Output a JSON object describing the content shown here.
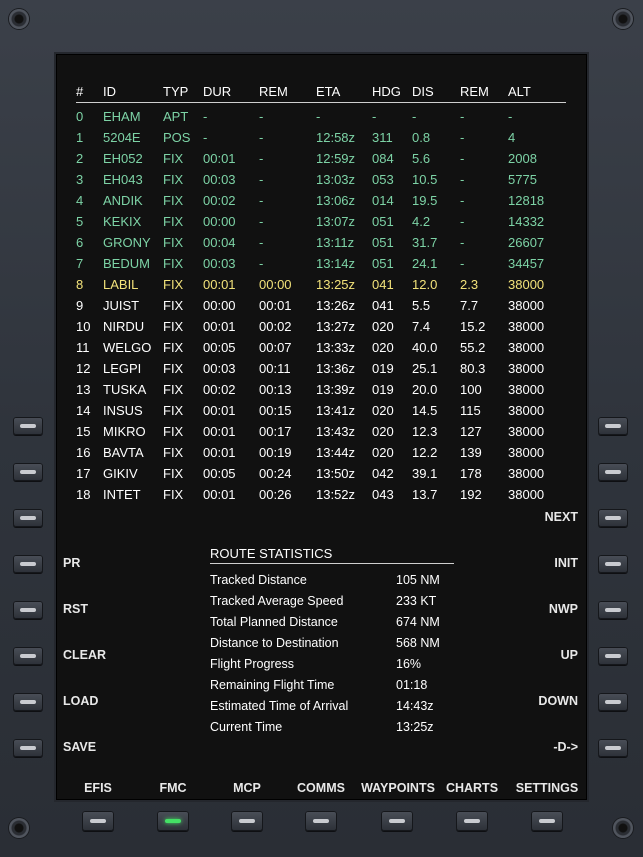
{
  "columns": [
    "#",
    "ID",
    "TYP",
    "DUR",
    "REM",
    "ETA",
    "HDG",
    "DIS",
    "REM",
    "ALT"
  ],
  "waypoints": [
    {
      "n": "0",
      "id": "EHAM",
      "typ": "APT",
      "dur": "-",
      "rem": "-",
      "eta": "-",
      "hdg": "-",
      "dis": "-",
      "rem2": "-",
      "alt": "-",
      "state": "past"
    },
    {
      "n": "1",
      "id": "5204E",
      "typ": "POS",
      "dur": "-",
      "rem": "-",
      "eta": "12:58z",
      "hdg": "311",
      "dis": "0.8",
      "rem2": "-",
      "alt": "4",
      "state": "past"
    },
    {
      "n": "2",
      "id": "EH052",
      "typ": "FIX",
      "dur": "00:01",
      "rem": "-",
      "eta": "12:59z",
      "hdg": "084",
      "dis": "5.6",
      "rem2": "-",
      "alt": "2008",
      "state": "past"
    },
    {
      "n": "3",
      "id": "EH043",
      "typ": "FIX",
      "dur": "00:03",
      "rem": "-",
      "eta": "13:03z",
      "hdg": "053",
      "dis": "10.5",
      "rem2": "-",
      "alt": "5775",
      "state": "past"
    },
    {
      "n": "4",
      "id": "ANDIK",
      "typ": "FIX",
      "dur": "00:02",
      "rem": "-",
      "eta": "13:06z",
      "hdg": "014",
      "dis": "19.5",
      "rem2": "-",
      "alt": "12818",
      "state": "past"
    },
    {
      "n": "5",
      "id": "KEKIX",
      "typ": "FIX",
      "dur": "00:00",
      "rem": "-",
      "eta": "13:07z",
      "hdg": "051",
      "dis": "4.2",
      "rem2": "-",
      "alt": "14332",
      "state": "past"
    },
    {
      "n": "6",
      "id": "GRONY",
      "typ": "FIX",
      "dur": "00:04",
      "rem": "-",
      "eta": "13:11z",
      "hdg": "051",
      "dis": "31.7",
      "rem2": "-",
      "alt": "26607",
      "state": "past"
    },
    {
      "n": "7",
      "id": "BEDUM",
      "typ": "FIX",
      "dur": "00:03",
      "rem": "-",
      "eta": "13:14z",
      "hdg": "051",
      "dis": "24.1",
      "rem2": "-",
      "alt": "34457",
      "state": "past"
    },
    {
      "n": "8",
      "id": "LABIL",
      "typ": "FIX",
      "dur": "00:01",
      "rem": "00:00",
      "eta": "13:25z",
      "hdg": "041",
      "dis": "12.0",
      "rem2": "2.3",
      "alt": "38000",
      "state": "active"
    },
    {
      "n": "9",
      "id": "JUIST",
      "typ": "FIX",
      "dur": "00:00",
      "rem": "00:01",
      "eta": "13:26z",
      "hdg": "041",
      "dis": "5.5",
      "rem2": "7.7",
      "alt": "38000",
      "state": "future"
    },
    {
      "n": "10",
      "id": "NIRDU",
      "typ": "FIX",
      "dur": "00:01",
      "rem": "00:02",
      "eta": "13:27z",
      "hdg": "020",
      "dis": "7.4",
      "rem2": "15.2",
      "alt": "38000",
      "state": "future"
    },
    {
      "n": "11",
      "id": "WELGO",
      "typ": "FIX",
      "dur": "00:05",
      "rem": "00:07",
      "eta": "13:33z",
      "hdg": "020",
      "dis": "40.0",
      "rem2": "55.2",
      "alt": "38000",
      "state": "future"
    },
    {
      "n": "12",
      "id": "LEGPI",
      "typ": "FIX",
      "dur": "00:03",
      "rem": "00:11",
      "eta": "13:36z",
      "hdg": "019",
      "dis": "25.1",
      "rem2": "80.3",
      "alt": "38000",
      "state": "future"
    },
    {
      "n": "13",
      "id": "TUSKA",
      "typ": "FIX",
      "dur": "00:02",
      "rem": "00:13",
      "eta": "13:39z",
      "hdg": "019",
      "dis": "20.0",
      "rem2": "100",
      "alt": "38000",
      "state": "future"
    },
    {
      "n": "14",
      "id": "INSUS",
      "typ": "FIX",
      "dur": "00:01",
      "rem": "00:15",
      "eta": "13:41z",
      "hdg": "020",
      "dis": "14.5",
      "rem2": "115",
      "alt": "38000",
      "state": "future"
    },
    {
      "n": "15",
      "id": "MIKRO",
      "typ": "FIX",
      "dur": "00:01",
      "rem": "00:17",
      "eta": "13:43z",
      "hdg": "020",
      "dis": "12.3",
      "rem2": "127",
      "alt": "38000",
      "state": "future"
    },
    {
      "n": "16",
      "id": "BAVTA",
      "typ": "FIX",
      "dur": "00:01",
      "rem": "00:19",
      "eta": "13:44z",
      "hdg": "020",
      "dis": "12.2",
      "rem2": "139",
      "alt": "38000",
      "state": "future"
    },
    {
      "n": "17",
      "id": "GIKIV",
      "typ": "FIX",
      "dur": "00:05",
      "rem": "00:24",
      "eta": "13:50z",
      "hdg": "042",
      "dis": "39.1",
      "rem2": "178",
      "alt": "38000",
      "state": "future"
    },
    {
      "n": "18",
      "id": "INTET",
      "typ": "FIX",
      "dur": "00:01",
      "rem": "00:26",
      "eta": "13:52z",
      "hdg": "043",
      "dis": "13.7",
      "rem2": "192",
      "alt": "38000",
      "state": "future"
    }
  ],
  "stats": {
    "title": "ROUTE STATISTICS",
    "rows": [
      {
        "label": "Tracked Distance",
        "value": "105 NM"
      },
      {
        "label": "Tracked Average Speed",
        "value": "233 KT"
      },
      {
        "label": "Total Planned Distance",
        "value": "674 NM"
      },
      {
        "label": "Distance to Destination",
        "value": "568 NM"
      },
      {
        "label": "Flight Progress",
        "value": "16%"
      },
      {
        "label": "Remaining Flight Time",
        "value": "01:18"
      },
      {
        "label": "Estimated Time of Arrival",
        "value": "14:43z"
      },
      {
        "label": "Current Time",
        "value": "13:25z"
      }
    ]
  },
  "left_keys": [
    "",
    "",
    "",
    "PR",
    "RST",
    "CLEAR",
    "LOAD",
    "SAVE"
  ],
  "right_keys": [
    "",
    "",
    "NEXT",
    "INIT",
    "NWP",
    "UP",
    "DOWN",
    "-D->"
  ],
  "bottom_tabs": [
    {
      "label": "EFIS",
      "lit": false
    },
    {
      "label": "FMC",
      "lit": true
    },
    {
      "label": "MCP",
      "lit": false
    },
    {
      "label": "COMMS",
      "lit": false
    },
    {
      "label": "WAYPOINTS",
      "lit": false
    },
    {
      "label": "CHARTS",
      "lit": false
    },
    {
      "label": "SETTINGS",
      "lit": false
    }
  ],
  "colors": {
    "past": "#7dd3a6",
    "active": "#f2e27a",
    "future": "#ffffff",
    "tab_led": "#44e065"
  }
}
